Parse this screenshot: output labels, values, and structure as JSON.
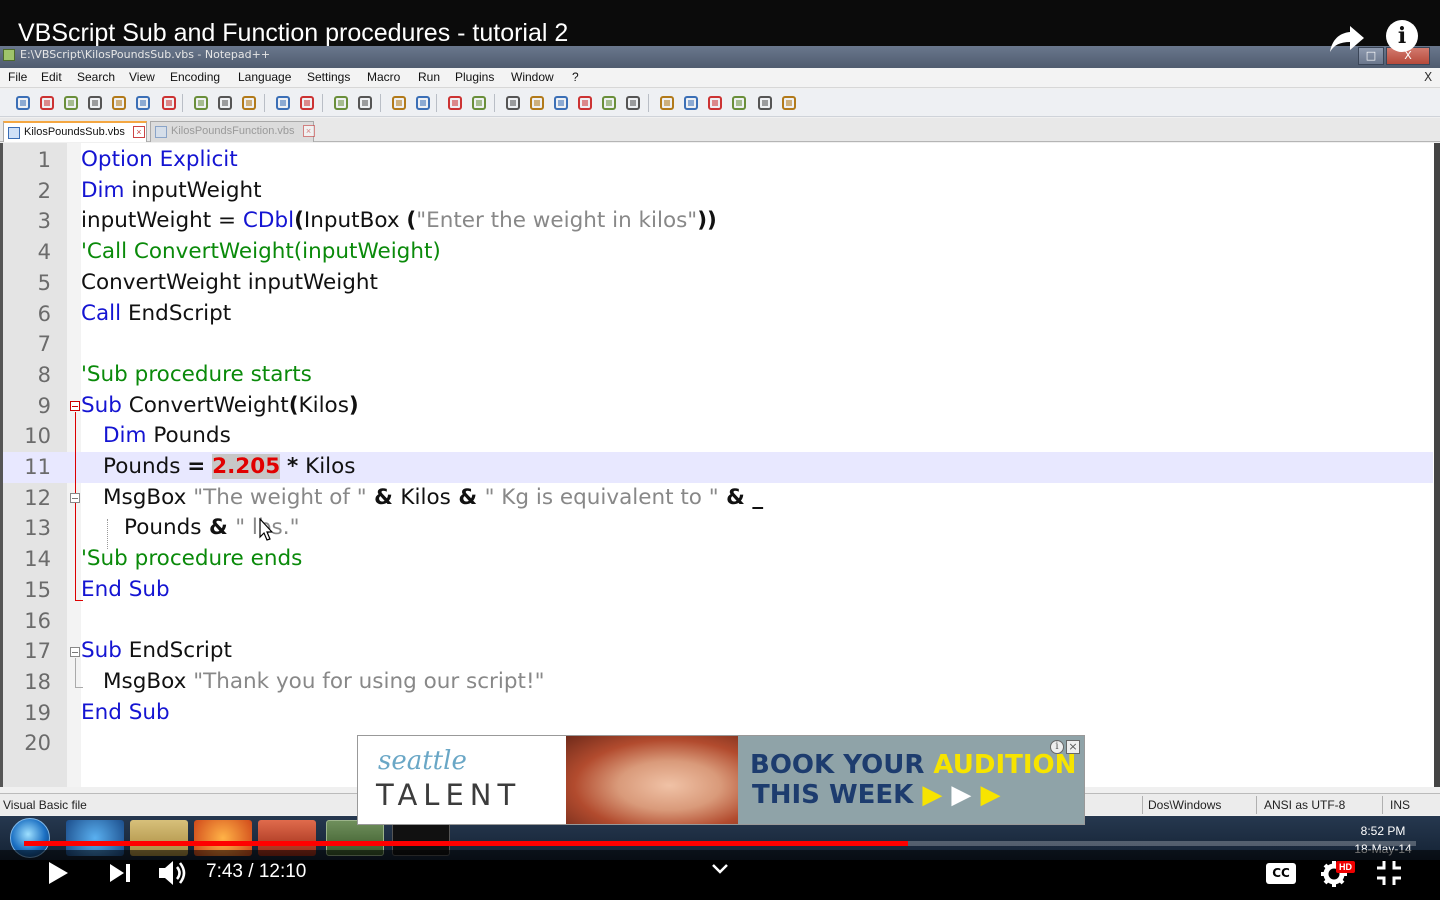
{
  "video": {
    "title": "VBScript Sub and Function procedures - tutorial 2",
    "time_current": "7:43",
    "time_total": "12:10",
    "time_display": "7:43 / 12:10",
    "progress_fraction": 0.635,
    "cc_label": "CC",
    "hd_label": "HD"
  },
  "window": {
    "title": "E:\\VBScript\\KilosPoundsSub.vbs - Notepad++",
    "min": "_",
    "max": "□",
    "close": "X"
  },
  "menu": {
    "items": [
      "File",
      "Edit",
      "Search",
      "View",
      "Encoding",
      "Language",
      "Settings",
      "Macro",
      "Run",
      "Plugins",
      "Window",
      "?"
    ],
    "close": "X"
  },
  "tabs": [
    {
      "label": "KilosPoundsSub.vbs",
      "active": true
    },
    {
      "label": "KilosPoundsFunction.vbs",
      "active": false
    }
  ],
  "editor": {
    "line_numbers": [
      "1",
      "2",
      "3",
      "4",
      "5",
      "6",
      "7",
      "8",
      "9",
      "10",
      "11",
      "12",
      "13",
      "14",
      "15",
      "16",
      "17",
      "18",
      "19",
      "20"
    ],
    "lines": {
      "l1": {
        "a": "Option Explicit"
      },
      "l2": {
        "a": "Dim",
        "b": " inputWeight"
      },
      "l3": {
        "a": "inputWeight = ",
        "b": "CDbl",
        "c": "(",
        "d": "InputBox ",
        "e": "(",
        "f": "\"Enter the weight in kilos\"",
        "g": "))"
      },
      "l4": {
        "a": "'Call ConvertWeight(inputWeight)"
      },
      "l5": {
        "a": "ConvertWeight inputWeight"
      },
      "l6": {
        "a": "Call",
        "b": " EndScript"
      },
      "l8": {
        "a": "'Sub procedure starts"
      },
      "l9": {
        "a": "Sub",
        "b": " ConvertWeight",
        "c": "(",
        "d": "Kilos",
        "e": ")"
      },
      "l10": {
        "a": "Dim",
        "b": " Pounds"
      },
      "l11": {
        "a": "Pounds ",
        "b": "=",
        "c": " ",
        "d": "2.205",
        "e": " ",
        "f": "*",
        "g": " Kilos"
      },
      "l12": {
        "a": "MsgBox ",
        "b": "\"The weight of \"",
        "c": " & ",
        "d": "Kilos",
        "e": " & ",
        "f": "\" Kg is equivalent to \"",
        "g": " & _"
      },
      "l13": {
        "a": "Pounds",
        "b": " & ",
        "c": "\" lbs.\""
      },
      "l14": {
        "a": "'Sub procedure ends"
      },
      "l15": {
        "a": "End Sub"
      },
      "l17": {
        "a": "Sub",
        "b": " EndScript"
      },
      "l18": {
        "a": "MsgBox ",
        "b": "\"Thank you for using our script!\""
      },
      "l19": {
        "a": "End Sub"
      }
    },
    "highlighted_line": 11
  },
  "status": {
    "language": "Visual Basic file",
    "eol": "Dos\\Windows",
    "encoding": "ANSI as UTF-8",
    "mode": "INS"
  },
  "taskbar": {
    "time": "8:52 PM",
    "date": "18-May-14"
  },
  "ad": {
    "logo_top": "seattle",
    "logo_main": "TALENT",
    "headline_a": "BOOK YOUR ",
    "headline_b": "AUDITION",
    "headline_c": "THIS WEEK",
    "info": "i",
    "close": "×"
  },
  "colors": {
    "keyword": "#1414d2",
    "comment": "#0a8a0a",
    "string": "#888888",
    "number": "#e10000",
    "progress": "#ff0000",
    "highlight_line": "#e8e8ff"
  }
}
